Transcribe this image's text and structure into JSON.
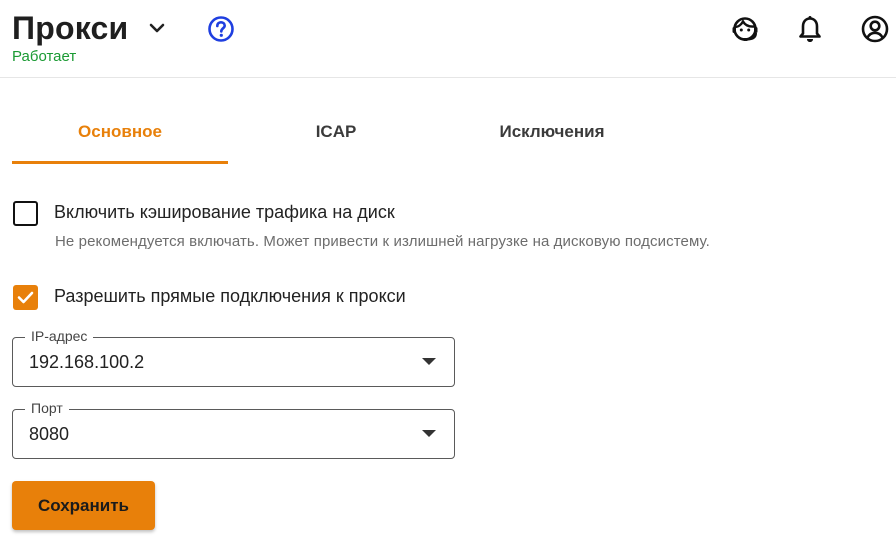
{
  "header": {
    "title": "Прокси",
    "status": "Работает"
  },
  "icons": {
    "title_dropdown": "chevron-down-icon",
    "help": "help-circle-icon",
    "support": "support-agent-icon",
    "notifications": "bell-icon",
    "account": "account-circle-icon"
  },
  "colors": {
    "accent": "#e8800a",
    "status_ok": "#1a9a33",
    "help_icon": "#1f3fe0"
  },
  "tabs": [
    {
      "label": "Основное",
      "active": true
    },
    {
      "label": "ICAP",
      "active": false
    },
    {
      "label": "Исключения",
      "active": false
    }
  ],
  "options": {
    "disk_cache": {
      "label": "Включить кэширование трафика на диск",
      "hint": "Не рекомендуется включать. Может привести к излишней нагрузке на дисковую подсистему.",
      "checked": false
    },
    "direct_connections": {
      "label": "Разрешить прямые подключения к прокси",
      "checked": true
    }
  },
  "fields": {
    "ip": {
      "label": "IP-адрес",
      "value": "192.168.100.2"
    },
    "port": {
      "label": "Порт",
      "value": "8080"
    }
  },
  "actions": {
    "save_label": "Сохранить"
  }
}
